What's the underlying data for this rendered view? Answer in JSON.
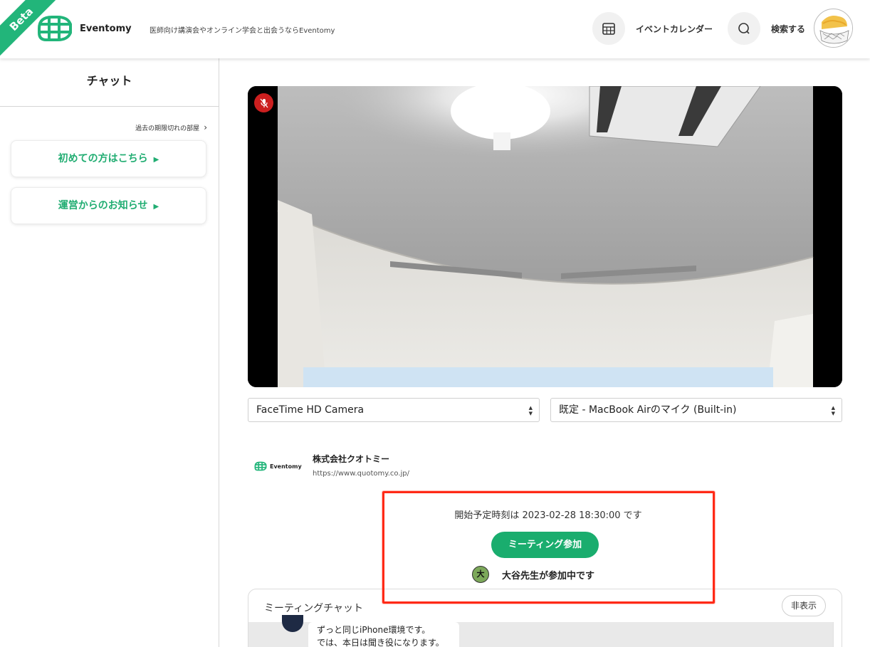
{
  "header": {
    "beta_label": "Beta",
    "logo_text": "Eventomy",
    "tagline": "医師向け講演会やオンライン学会と出会うならEventomy",
    "calendar_label": "イベントカレンダー",
    "search_label": "検索する",
    "icons": {
      "calendar": "calendar-icon",
      "search": "search-icon"
    },
    "accent_color": "#22b57a"
  },
  "sidebar": {
    "title": "チャット",
    "expired_link": "過去の期限切れの部屋",
    "cards": [
      {
        "label": "初めての方はこちら"
      },
      {
        "label": "運営からのお知らせ"
      }
    ]
  },
  "video": {
    "mic_muted": true,
    "camera_select": "FaceTime HD Camera",
    "mic_select": "既定 - MacBook Airのマイク (Built-in)"
  },
  "organizer": {
    "logo_text": "Eventomy",
    "name": "株式会社クオトミー",
    "url": "https://www.quotomy.co.jp/"
  },
  "meeting": {
    "start_time": "開始予定時刻は 2023-02-28 18:30:00 です",
    "join_label": "ミーティング参加",
    "participant_initial": "大",
    "participant_text": "大谷先生が参加中です",
    "join_color": "#1aad6e",
    "highlight_color": "#ff2a17"
  },
  "chat": {
    "title": "ミーティングチャット",
    "hide_label": "非表示",
    "messages": [
      {
        "line1": "ずっと同じiPhone環境です。",
        "line2": "では、本日は聞き役になります。"
      }
    ]
  }
}
